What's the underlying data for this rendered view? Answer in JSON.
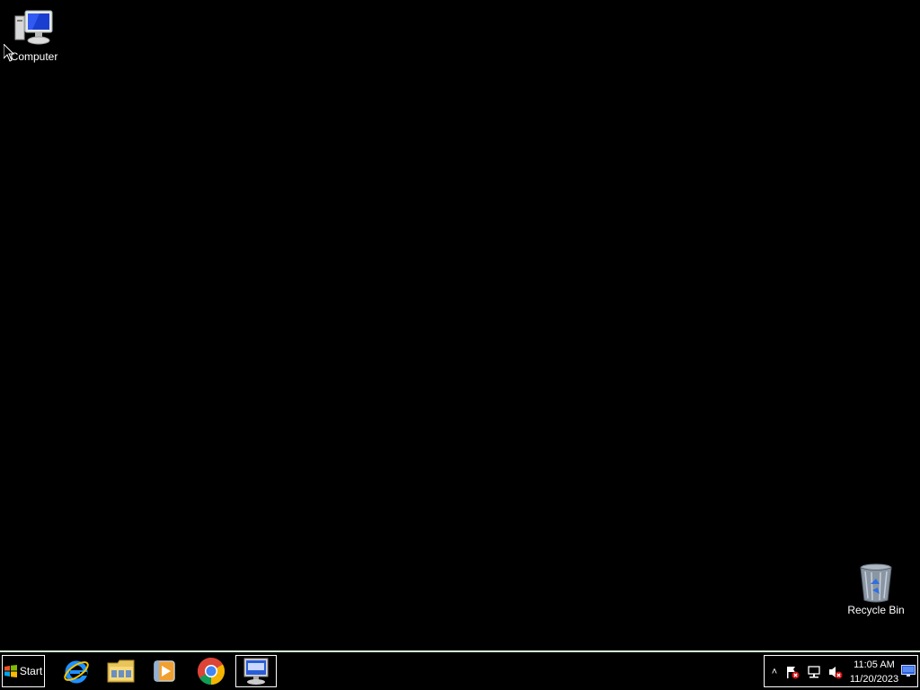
{
  "desktop": {
    "icons": [
      {
        "label": "Computer",
        "icon": "computer-icon"
      },
      {
        "label": "Recycle Bin",
        "icon": "recycle-bin-icon"
      }
    ]
  },
  "taskbar": {
    "start_label": "Start",
    "pinned": [
      {
        "icon": "internet-explorer-icon"
      },
      {
        "icon": "file-explorer-icon"
      },
      {
        "icon": "media-player-icon"
      },
      {
        "icon": "chrome-icon"
      },
      {
        "icon": "on-screen-keyboard-icon",
        "active": true
      }
    ],
    "tray": {
      "chevron": "˄",
      "icons": [
        "action-center-flag-icon",
        "network-icon",
        "volume-muted-icon",
        "show-desktop-icon"
      ],
      "time": "11:05 AM",
      "date": "11/20/2023"
    }
  },
  "colors": {
    "desktop_bg": "#000000",
    "taskbar_border": "#d8f0d8",
    "text": "#ffffff"
  }
}
